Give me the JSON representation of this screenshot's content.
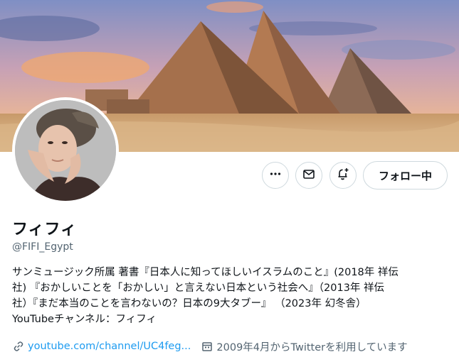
{
  "profile": {
    "display_name": "フィフィ",
    "handle": "@FIFI_Egypt",
    "bio_lines": [
      "サンミュージック所属 著書『日本人に知ってほしいイスラムのこと』(2018年 祥伝",
      "社) 『おかしいことを「おかしい」と言えない日本という社会へ』（2013年 祥伝",
      "社）『まだ本当のことを言わないの？日本の9大タブー』 （2023年 幻冬舎）",
      "YouTubeチャンネル：フィフィ"
    ],
    "website": "youtube.com/channel/UC4feg...",
    "joined": "2009年4月からTwitterを利用しています"
  },
  "actions": {
    "follow_label": "フォロー中"
  },
  "icons": {
    "more": "more-icon",
    "mail": "mail-icon",
    "notify": "bell-plus-icon",
    "link": "link-icon",
    "calendar": "calendar-icon"
  },
  "colors": {
    "link": "#1d9bf0",
    "secondary_text": "#536471",
    "border": "#cfd9de"
  }
}
